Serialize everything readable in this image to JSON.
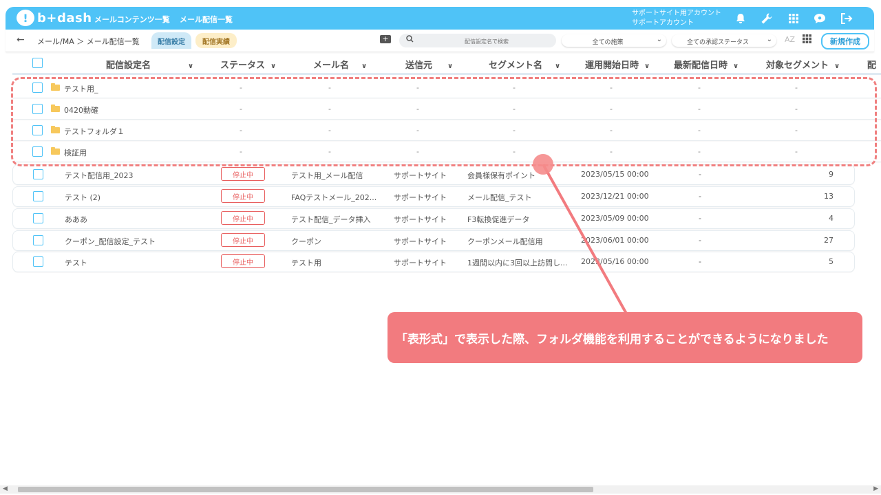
{
  "header": {
    "logo_text": "b+dash",
    "nav": [
      "メールコンテンツ一覧",
      "メール配信一覧"
    ],
    "account_line1": "サポートサイト用アカウント",
    "account_line2": "サポートアカウント"
  },
  "toolbar": {
    "back": "←",
    "breadcrumb": "メール/MA ＞ メール配信一覧",
    "tab_settings": "配信設定",
    "tab_results": "配信実績",
    "search_placeholder": "配信設定名で検索",
    "measures_select": "全ての施策",
    "approval_select": "全ての承認ステータス",
    "az_label": "AZ",
    "new_button": "新規作成"
  },
  "columns": [
    "配信設定名",
    "ステータス",
    "メール名",
    "送信元",
    "セグメント名",
    "運用開始日時",
    "最新配信日時",
    "対象セグメント",
    "配"
  ],
  "folders": [
    {
      "name": "テスト用_",
      "values": [
        "-",
        "-",
        "-",
        "-",
        "-",
        "-",
        "-"
      ]
    },
    {
      "name": "0420動確",
      "values": [
        "-",
        "-",
        "-",
        "-",
        "-",
        "-",
        "-"
      ]
    },
    {
      "name": "テストフォルダ１",
      "values": [
        "-",
        "-",
        "-",
        "-",
        "-",
        "-",
        "-"
      ]
    },
    {
      "name": "検証用",
      "values": [
        "-",
        "-",
        "-",
        "-",
        "-",
        "-",
        "-"
      ]
    }
  ],
  "rows": [
    {
      "name": "テスト配信用_2023",
      "status": "停止中",
      "mail": "テスト用_メール配信",
      "sender": "サポートサイト",
      "segment": "会員様保有ポイント",
      "start": "2023/05/15 00:00",
      "latest": "-",
      "count": "9"
    },
    {
      "name": "テスト (2)",
      "status": "停止中",
      "mail": "FAQテストメール_202...",
      "sender": "サポートサイト",
      "segment": "メール配信_テスト",
      "start": "2023/12/21 00:00",
      "latest": "-",
      "count": "13"
    },
    {
      "name": "あああ",
      "status": "停止中",
      "mail": "テスト配信_データ挿入",
      "sender": "サポートサイト",
      "segment": "F3転換促進データ",
      "start": "2023/05/09 00:00",
      "latest": "-",
      "count": "4"
    },
    {
      "name": "クーポン_配信設定_テスト",
      "status": "停止中",
      "mail": "クーポン",
      "sender": "サポートサイト",
      "segment": "クーポンメール配信用",
      "start": "2023/06/01 00:00",
      "latest": "-",
      "count": "27"
    },
    {
      "name": "テスト",
      "status": "停止中",
      "mail": "テスト用",
      "sender": "サポートサイト",
      "segment": "1週間以内に3回以上訪問し...",
      "start": "2023/05/16 00:00",
      "latest": "-",
      "count": "5"
    }
  ],
  "callout": "「表形式」で表示した際、フォルダ機能を利用することができるようになりました",
  "colors": {
    "brand": "#4fc3f7",
    "stopped": "#e85d5d",
    "annotation": "#f27b7f"
  }
}
